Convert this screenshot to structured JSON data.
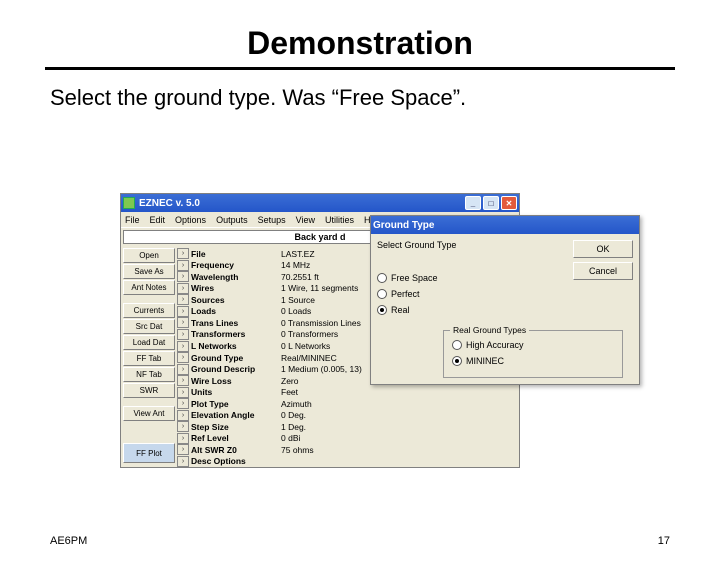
{
  "slide": {
    "title": "Demonstration",
    "instruction": "Select the ground type.  Was “Free Space”.",
    "footer_left": "AE6PM",
    "footer_right": "17"
  },
  "app": {
    "title": "EZNEC  v. 5.0",
    "winbtn_min": "_",
    "winbtn_max": "□",
    "winbtn_close": "✕",
    "menu": [
      "File",
      "Edit",
      "Options",
      "Outputs",
      "Setups",
      "View",
      "Utilities",
      "Help"
    ],
    "banner": "Back yard d",
    "sidebar": {
      "open": "Open",
      "saveas": "Save As",
      "antnotes": "Ant Notes",
      "currents": "Currents",
      "srcdat": "Src Dat",
      "loaddat": "Load Dat",
      "fftab": "FF Tab",
      "nftab": "NF Tab",
      "swr": "SWR",
      "viewant": "View Ant",
      "ffplot": "FF Plot"
    },
    "props": [
      {
        "label": "File",
        "value": "LAST.EZ"
      },
      {
        "label": "Frequency",
        "value": "14 MHz"
      },
      {
        "label": "Wavelength",
        "value": "70.2551 ft"
      },
      {
        "label": "Wires",
        "value": "1 Wire, 11 segments"
      },
      {
        "label": "Sources",
        "value": "1 Source"
      },
      {
        "label": "Loads",
        "value": "0 Loads"
      },
      {
        "label": "Trans Lines",
        "value": "0 Transmission Lines"
      },
      {
        "label": "Transformers",
        "value": "0 Transformers"
      },
      {
        "label": "L Networks",
        "value": "0 L Networks"
      },
      {
        "label": "Ground Type",
        "value": "Real/MININEC"
      },
      {
        "label": "Ground Descrip",
        "value": "1 Medium (0.005, 13)"
      },
      {
        "label": "Wire Loss",
        "value": "Zero"
      },
      {
        "label": "Units",
        "value": "Feet"
      },
      {
        "label": "Plot Type",
        "value": "Azimuth"
      },
      {
        "label": "Elevation Angle",
        "value": "0 Deg."
      },
      {
        "label": "Step Size",
        "value": "1 Deg."
      },
      {
        "label": "Ref Level",
        "value": "0 dBi"
      },
      {
        "label": "Alt SWR Z0",
        "value": "75 ohms"
      },
      {
        "label": "Desc Options",
        "value": ""
      }
    ],
    "chevron": "›"
  },
  "dialog": {
    "title": "Ground Type",
    "label": "Select Ground Type",
    "ok": "OK",
    "cancel": "Cancel",
    "options": {
      "free": "Free Space",
      "perfect": "Perfect",
      "real": "Real"
    },
    "group_title": "Real Ground Types",
    "group_options": {
      "high": "High Accuracy",
      "mininec": "MININEC"
    }
  }
}
